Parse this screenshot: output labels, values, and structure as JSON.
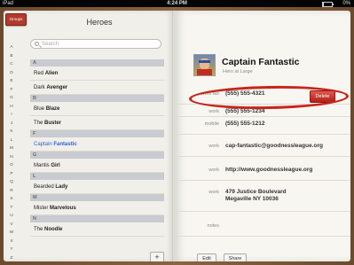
{
  "status_bar": {
    "device": "iPad",
    "time": "4:24 PM",
    "battery": "0%",
    "battery_level": 0.05
  },
  "left_page": {
    "groups_label": "Groups",
    "title": "Heroes",
    "search_placeholder": "Search",
    "index": [
      "A",
      "B",
      "C",
      "D",
      "E",
      "F",
      "G",
      "H",
      "I",
      "J",
      "K",
      "L",
      "M",
      "N",
      "O",
      "P",
      "Q",
      "R",
      "S",
      "T",
      "U",
      "V",
      "W",
      "X",
      "Y",
      "Z",
      "#"
    ],
    "sections": [
      {
        "header": "A",
        "rows": [
          {
            "first": "Red ",
            "last": "Alien"
          },
          {
            "first": "Dark ",
            "last": "Avenger"
          }
        ]
      },
      {
        "header": "B",
        "rows": [
          {
            "first": "Blue ",
            "last": "Blaze"
          },
          {
            "first": "The ",
            "last": "Buster"
          }
        ]
      },
      {
        "header": "F",
        "rows": [
          {
            "first": "Captain ",
            "last": "Fantastic",
            "selected": true
          }
        ]
      },
      {
        "header": "G",
        "rows": [
          {
            "first": "Mantis ",
            "last": "Girl"
          }
        ]
      },
      {
        "header": "L",
        "rows": [
          {
            "first": "Bearded ",
            "last": "Lady"
          }
        ]
      },
      {
        "header": "M",
        "rows": [
          {
            "first": "Mister ",
            "last": "Marvelous"
          }
        ]
      },
      {
        "header": "N",
        "rows": [
          {
            "first": "The ",
            "last": "Noodle"
          }
        ]
      }
    ],
    "add_label": "+"
  },
  "right_page": {
    "name": "Captain Fantastic",
    "subtitle": "Hero at Large",
    "fields": [
      {
        "label": "work fax",
        "value": "(555) 555-4321"
      },
      {
        "label": "work",
        "value": "(555) 555-1234"
      },
      {
        "label": "mobile",
        "value": "(555) 555-1212"
      },
      {
        "label": "work",
        "value": "cap-fantastic@goodnessleague.org"
      },
      {
        "label": "work",
        "value": "http://www.goodnessleague.org"
      },
      {
        "label": "work",
        "value": "479 Justice Boulevard",
        "value2": "Megaville NY 10036"
      },
      {
        "label": "notes",
        "value": ""
      }
    ],
    "delete_label": "Delete",
    "edit_label": "Edit",
    "share_label": "Share"
  },
  "colors": {
    "accent_red": "#c7251c",
    "selected_blue": "#2d5fd6"
  }
}
